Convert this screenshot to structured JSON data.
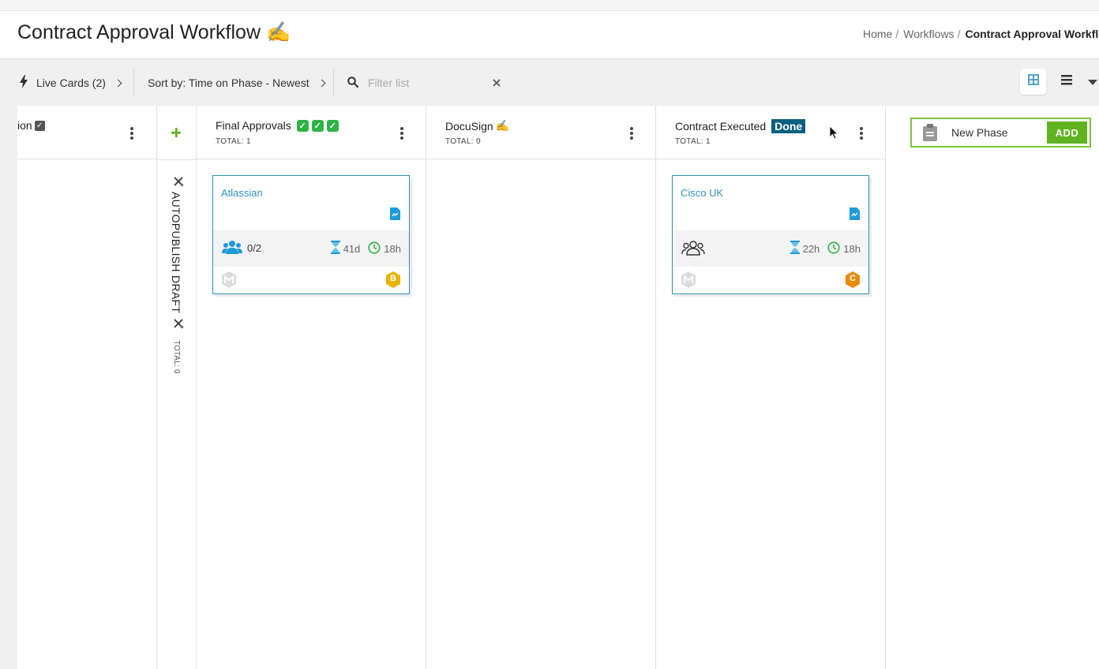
{
  "header": {
    "title": "Contract Approval Workflow",
    "title_emoji": "✍",
    "breadcrumb": [
      "Home",
      "Workflows",
      "Contract Approval Workflo"
    ]
  },
  "toolbar": {
    "live_cards_label": "Live Cards (2)",
    "sort_label": "Sort by: Time on Phase - Newest",
    "filter_placeholder": "Filter list"
  },
  "columns": [
    {
      "title": "ion",
      "title_icon": "check-square-icon"
    },
    {
      "title": "AUTOPUBLISH DRAFT",
      "total": "TOTAL: 0",
      "collapsed": true
    },
    {
      "title": "Final Approvals",
      "total": "TOTAL: 1",
      "emoji": [
        "✓",
        "✓",
        "✓"
      ]
    },
    {
      "title": "DocuSign",
      "emoji": "✍",
      "total": "TOTAL: 0"
    },
    {
      "title": "Contract Executed",
      "badge": "Done",
      "total": "TOTAL: 1"
    }
  ],
  "cards": [
    {
      "name": "Atlassian",
      "members": "0/2",
      "time_on_phase": "41d",
      "time_total": "18h",
      "priority": "B",
      "priority_color": "#e8b400"
    },
    {
      "name": "Cisco UK",
      "members": "",
      "time_on_phase": "22h",
      "time_total": "18h",
      "priority": "C",
      "priority_color": "#e88a00"
    }
  ],
  "new_phase": {
    "label": "New Phase",
    "add_label": "ADD"
  },
  "colors": {
    "accent": "#2f8fbd",
    "add_green": "#5fb320",
    "done_badge": "#0a5f7f",
    "check_green": "#2fb344"
  }
}
